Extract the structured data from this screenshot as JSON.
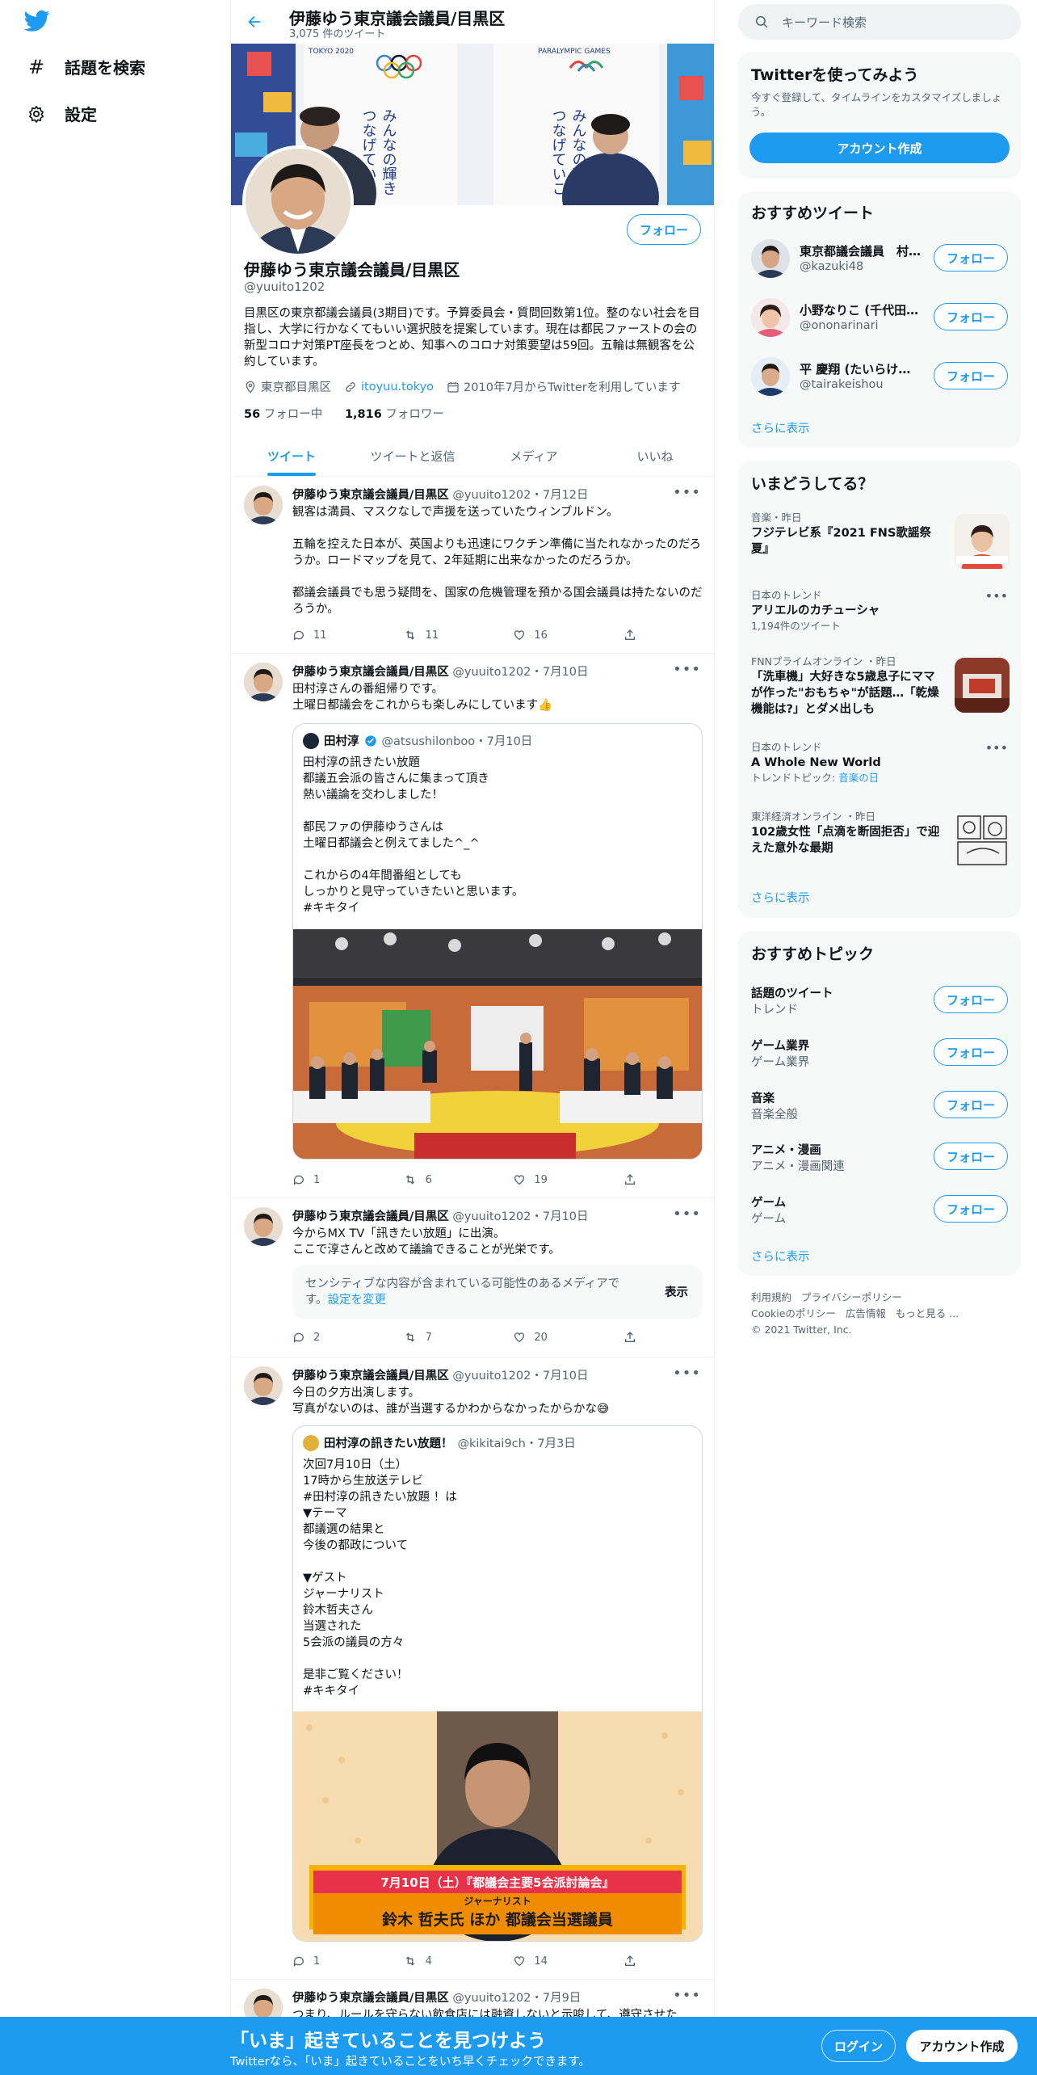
{
  "nav": {
    "explore": "話題を検索",
    "settings": "設定"
  },
  "header": {
    "name": "伊藤ゆう東京議会議員/目黒区",
    "tweet_count": "3,075 件のツイート"
  },
  "profile": {
    "follow": "フォロー",
    "name": "伊藤ゆう東京議会議員/目黒区",
    "handle": "@yuuito1202",
    "bio": "目黒区の東京都議会議員(3期目)です。予算委員会・質問回数第1位。整のない社会を目指し、大学に行かなくてもいい選択肢を提案しています。現在は都民ファーストの会の新型コロナ対策PT座長をつとめ、知事へのコロナ対策要望は59回。五輪は無観客を公約しています。",
    "location": "東京都目黒区",
    "url": "itoyuu.tokyo",
    "joined": "2010年7月からTwitterを利用しています",
    "following_num": "56",
    "following_label": " フォロー中",
    "followers_num": "1,816",
    "followers_label": " フォロワー"
  },
  "tabs": [
    "ツイート",
    "ツイートと返信",
    "メディア",
    "いいね"
  ],
  "tweets": [
    {
      "name": "伊藤ゆう東京議会議員/目黒区",
      "meta": "@yuuito1202・7月12日",
      "text": "観客は満員、マスクなしで声援を送っていたウィンブルドン。\n\n五輪を控えた日本が、英国よりも迅速にワクチン準備に当たれなかったのだろうか。ロードマップを見て、2年延期に出来なかったのだろうか。\n\n都議会議員でも思う疑問を、国家の危機管理を預かる国会議員は持たないのだろうか。",
      "reply": "11",
      "retweet": "11",
      "like": "16"
    },
    {
      "name": "伊藤ゆう東京議会議員/目黒区",
      "meta": "@yuuito1202・7月10日",
      "text": "田村淳さんの番組帰りです。\n土曜日都議会をこれからも楽しみにしています👍",
      "quote_name": "田村淳",
      "quote_meta": "@atsushilonboo・7月10日",
      "quote_text": "田村淳の訊きたい放題\n都議五会派の皆さんに集まって頂き\n熱い議論を交わしました！\n\n都民ファの伊藤ゆうさんは\n土曜日都議会と例えてました^_^\n\nこれからの4年間番組としても\nしっかりと見守っていきたいと思います。\n#キキタイ",
      "reply": "1",
      "retweet": "6",
      "like": "19"
    },
    {
      "name": "伊藤ゆう東京議会議員/目黒区",
      "meta": "@yuuito1202・7月10日",
      "text": "今からMX TV「訊きたい放題」に出演。\nここで淳さんと改めて議論できることが光栄です。",
      "sensitive_text": "センシティブな内容が含まれている可能性のあるメディアです。",
      "sensitive_link": "設定を変更",
      "sensitive_button": "表示",
      "reply": "2",
      "retweet": "7",
      "like": "20"
    },
    {
      "name": "伊藤ゆう東京議会議員/目黒区",
      "meta": "@yuuito1202・7月10日",
      "text": "今日の夕方出演します。\n写真がないのは、誰が当選するかわからなかったからかな😅",
      "quote_name": "田村淳の訊きたい放題！",
      "quote_meta": "@kikitai9ch・7月3日",
      "quote_text": "次回7月10日（土）\n17時から生放送テレビ\n#田村淳の訊きたい放題 ！は\n▼テーマ\n都議選の結果と\n今後の都政について\n\n▼ゲスト\nジャーナリスト\n鈴木哲夫さん\n当選された\n5会派の議員の方々\n\n是非ご覧ください！\n#キキタイ",
      "promo_line1": "7月10日（土）『都議会主要5会派討論会』",
      "promo_line2": "ジャーナリスト",
      "promo_line3": "鈴木 哲夫氏 ほか 都議会当選議員",
      "reply": "1",
      "retweet": "4",
      "like": "14"
    },
    {
      "name": "伊藤ゆう東京議会議員/目黒区",
      "meta": "@yuuito1202・7月9日",
      "text": "つまり、ルールを守らない飲食店には融資しないと示唆して、遵守させた"
    }
  ],
  "right": {
    "search_placeholder": "キーワード検索",
    "try_title": "Twitterを使ってみよう",
    "try_desc": "今すぐ登録して、タイムラインをカスタマイズしましょう。",
    "signup": "アカウント作成",
    "rec_title": "おすすめツイート",
    "rec_users": [
      {
        "name": "東京都議会議員　村…",
        "handle": "@kazuki48"
      },
      {
        "name": "小野なりこ (千代田…",
        "handle": "@ononarinari"
      },
      {
        "name": "平 慶翔 (たいらけい…",
        "handle": "@tairakeishou"
      }
    ],
    "follow": "フォロー",
    "more": "さらに表示",
    "now_title": "いまどうしてる？",
    "trends": [
      {
        "ctx": "音楽・昨日",
        "title": "フジテレビ系『2021 FNS歌謡祭夏』",
        "sub": ""
      },
      {
        "ctx": "日本のトレンド",
        "title": "アリエルのカチューシャ",
        "sub": "1,194件のツイート"
      },
      {
        "ctx": "FNNプライムオンライン ・昨日",
        "title": "「洗車機」大好きな5歳息子にママが作った\"おもちゃ\"が話題…「乾燥機能は?」とダメ出しも",
        "sub": ""
      },
      {
        "ctx": "日本のトレンド",
        "title": "A Whole New World",
        "sub": "トレンドトピック: ",
        "sub_link": "音楽の日"
      },
      {
        "ctx": "東洋経済オンライン ・昨日",
        "title": "102歳女性「点滴を断固拒否」で迎えた意外な最期",
        "sub": ""
      }
    ],
    "topics_title": "おすすめトピック",
    "topics": [
      {
        "name": "話題のツイート",
        "cat": "トレンド"
      },
      {
        "name": "ゲーム業界",
        "cat": "ゲーム業界"
      },
      {
        "name": "音楽",
        "cat": "音楽全般"
      },
      {
        "name": "アニメ・漫画",
        "cat": "アニメ・漫画関連"
      },
      {
        "name": "ゲーム",
        "cat": "ゲーム"
      }
    ],
    "footer": [
      "利用規約",
      "プライバシーポリシー",
      "Cookieのポリシー",
      "広告情報",
      "もっと見る ...",
      "© 2021 Twitter, Inc."
    ]
  },
  "bottom": {
    "title": "「いま」起きていることを見つけよう",
    "sub": "Twitterなら、「いま」起きていることをいち早くチェックできます。",
    "login": "ログイン",
    "signup": "アカウント作成"
  },
  "banner_text": {
    "left": "みんなの輝き\nつなげていこう。",
    "right": "みんなの輝\nつなげていこ",
    "logo_left": "TOKYO 2020",
    "logo_right": "PARALYMPIC GAMES"
  },
  "colors": {
    "accent": "#1d9bf0",
    "bottom_bar": "#1d9bf0"
  }
}
